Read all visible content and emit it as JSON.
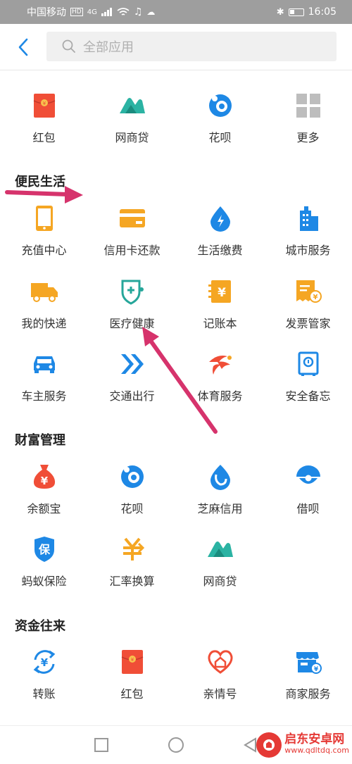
{
  "statusbar": {
    "carrier": "中国移动",
    "hd": "HD",
    "network": "4G",
    "time": "16:05"
  },
  "search": {
    "placeholder": "全部应用"
  },
  "top_apps": [
    {
      "label": "红包",
      "icon": "red-envelope-icon"
    },
    {
      "label": "网商贷",
      "icon": "mybank-loan-icon"
    },
    {
      "label": "花呗",
      "icon": "huabei-icon"
    },
    {
      "label": "更多",
      "icon": "grid-more-icon"
    }
  ],
  "sections": [
    {
      "title": "便民生活",
      "rows": [
        [
          {
            "label": "充值中心",
            "icon": "phone-recharge-icon"
          },
          {
            "label": "信用卡还款",
            "icon": "credit-card-icon"
          },
          {
            "label": "生活缴费",
            "icon": "utility-drop-icon"
          },
          {
            "label": "城市服务",
            "icon": "city-building-icon"
          }
        ],
        [
          {
            "label": "我的快递",
            "icon": "delivery-truck-icon"
          },
          {
            "label": "医疗健康",
            "icon": "medical-shield-icon"
          },
          {
            "label": "记账本",
            "icon": "ledger-book-icon"
          },
          {
            "label": "发票管家",
            "icon": "invoice-icon"
          }
        ],
        [
          {
            "label": "车主服务",
            "icon": "car-icon"
          },
          {
            "label": "交通出行",
            "icon": "double-chevron-icon"
          },
          {
            "label": "体育服务",
            "icon": "sports-icon"
          },
          {
            "label": "安全备忘",
            "icon": "safe-box-icon"
          }
        ]
      ]
    },
    {
      "title": "财富管理",
      "rows": [
        [
          {
            "label": "余额宝",
            "icon": "money-bag-icon"
          },
          {
            "label": "花呗",
            "icon": "huabei-icon"
          },
          {
            "label": "芝麻信用",
            "icon": "sesame-credit-icon"
          },
          {
            "label": "借呗",
            "icon": "jiebei-icon"
          }
        ],
        [
          {
            "label": "蚂蚁保险",
            "icon": "insurance-shield-icon"
          },
          {
            "label": "汇率换算",
            "icon": "exchange-rate-icon"
          },
          {
            "label": "网商贷",
            "icon": "mybank-loan-icon"
          }
        ]
      ]
    },
    {
      "title": "资金往来",
      "rows": [
        [
          {
            "label": "转账",
            "icon": "transfer-icon"
          },
          {
            "label": "红包",
            "icon": "red-envelope-icon"
          },
          {
            "label": "亲情号",
            "icon": "family-heart-icon"
          },
          {
            "label": "商家服务",
            "icon": "merchant-icon"
          }
        ]
      ]
    }
  ],
  "watermark": {
    "title": "启东安卓网",
    "url": "www.qdltdq.com"
  },
  "colors": {
    "blue": "#1e88e5",
    "orange": "#f5a623",
    "red": "#f04e37",
    "teal": "#26a69a",
    "arrow": "#d6336c"
  }
}
